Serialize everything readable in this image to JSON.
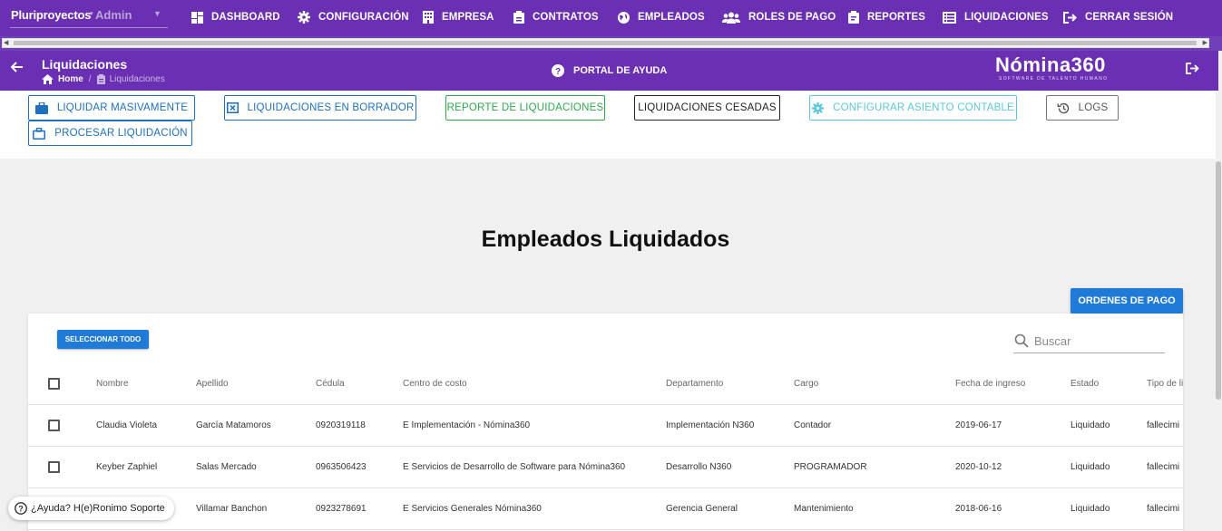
{
  "nav": {
    "company": "Pluriproyectos",
    "role": "Admin",
    "items": [
      {
        "label": "DASHBOARD",
        "icon": "dashboard-icon"
      },
      {
        "label": "CONFIGURACIÓN",
        "icon": "gear-icon"
      },
      {
        "label": "EMPRESA",
        "icon": "building-icon"
      },
      {
        "label": "CONTRATOS",
        "icon": "clipboard-icon"
      },
      {
        "label": "EMPLEADOS",
        "icon": "globe-icon"
      },
      {
        "label": "ROLES DE PAGO",
        "icon": "users-icon"
      },
      {
        "label": "REPORTES",
        "icon": "report-icon"
      },
      {
        "label": "LIQUIDACIONES",
        "icon": "list-icon"
      },
      {
        "label": "CERRAR SESIÓN",
        "icon": "sign-out-icon"
      }
    ]
  },
  "header": {
    "title": "Liquidaciones",
    "breadcrumb_home": "Home",
    "breadcrumb_current": "Liquidaciones",
    "help_label": "PORTAL DE AYUDA",
    "logo_main": "Nómina360",
    "logo_sub": "SOFTWARE DE TALENTO HUMANO"
  },
  "actions": {
    "liquidar_masivamente": "LIQUIDAR MASIVAMENTE",
    "liquidaciones_borrador": "LIQUIDACIONES EN BORRADOR",
    "reporte_liquidaciones": "REPORTE DE LIQUIDACIONES",
    "liquidaciones_cesadas": "LIQUIDACIONES CESADAS",
    "configurar_asiento": "CONFIGURAR ASIENTO CONTABLE",
    "logs": "LOGS",
    "procesar_liquidacion": "PROCESAR LIQUIDACIÓN"
  },
  "main": {
    "title": "Empleados Liquidados",
    "ordenes_label": "ORDENES DE PAGO",
    "select_all_label": "SELECCIONAR TODO",
    "search_placeholder": "Buscar"
  },
  "table": {
    "columns": [
      "Nombre",
      "Apellido",
      "Cédula",
      "Centro de costo",
      "Departamento",
      "Cargo",
      "Fecha de ingreso",
      "Estado",
      "Tipo de li"
    ],
    "rows": [
      [
        "Claudia Violeta",
        "García Matamoros",
        "0920319118",
        "E Implementación - Nómina360",
        "Implementación N360",
        "Contador",
        "2019-06-17",
        "Liquidado",
        "fallecimi"
      ],
      [
        "Keyber Zaphiel",
        "Salas Mercado",
        "0963506423",
        "E Servicios de Desarrollo de Software para Nómina360",
        "Desarrollo N360",
        "PROGRAMADOR",
        "2020-10-12",
        "Liquidado",
        "fallecimi"
      ],
      [
        "",
        "Villamar Banchon",
        "0923278691",
        "E Servicios Generales Nómina360",
        "Gerencia General",
        "Mantenimiento",
        "2018-06-16",
        "Liquidado",
        "fallecimi"
      ]
    ]
  },
  "support": {
    "label": "¿Ayuda? H(e)Ronimo Soporte"
  },
  "colors": {
    "header_purple": "#6a2fb3",
    "primary_blue": "#1f7ad8",
    "success_green": "#2fa84a",
    "info_cyan": "#5cc7dc"
  }
}
